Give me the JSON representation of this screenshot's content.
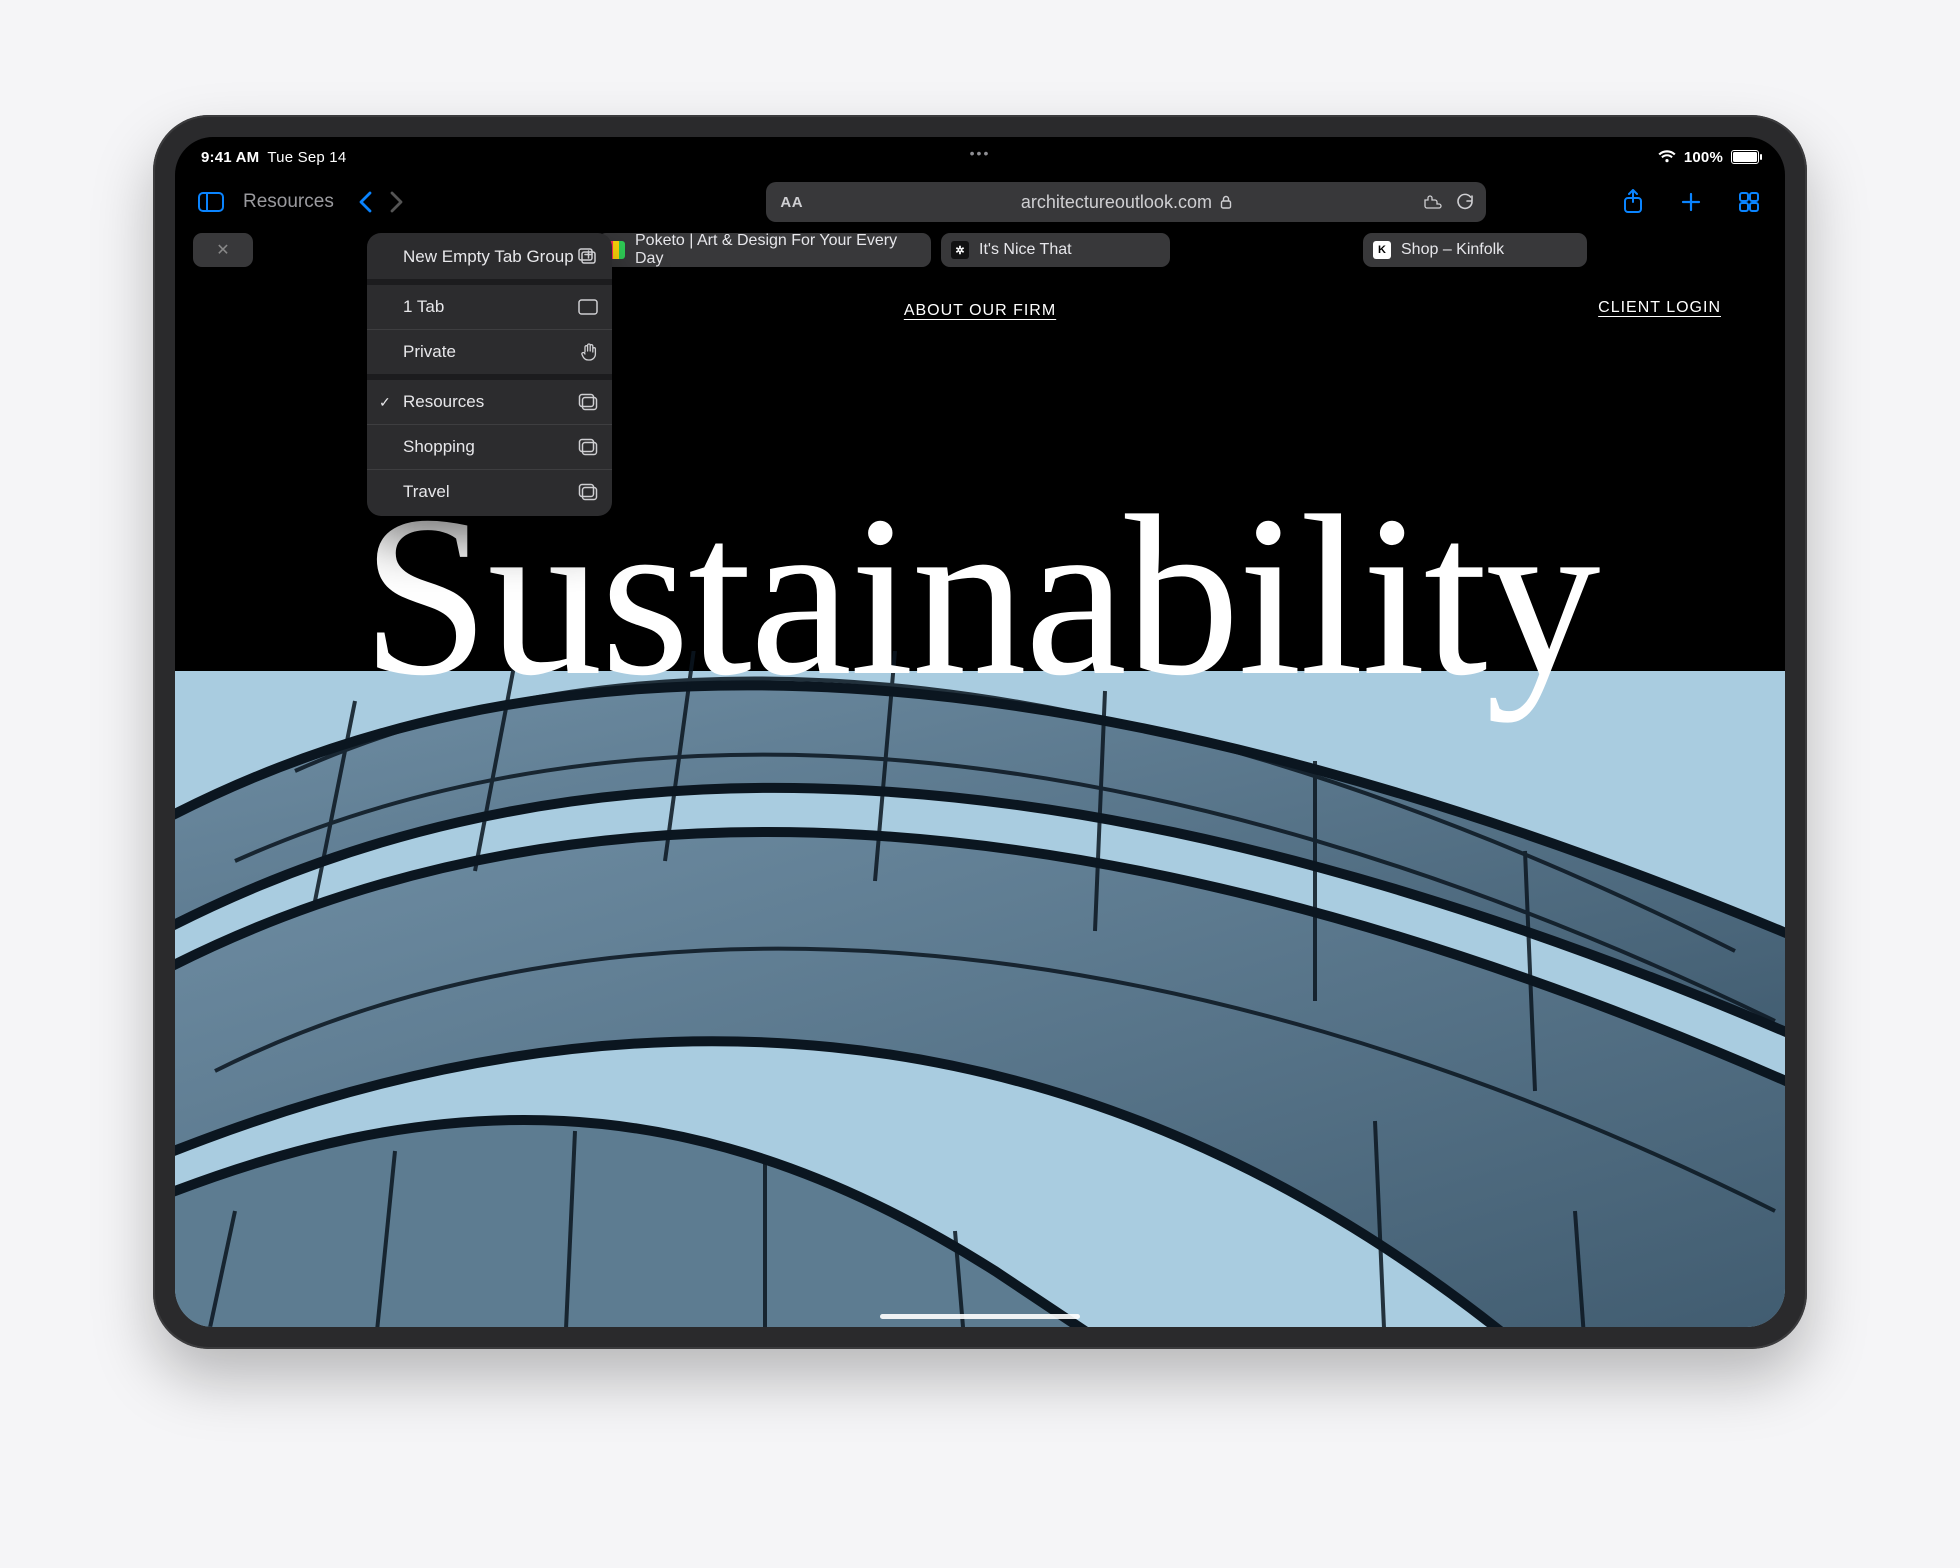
{
  "statusbar": {
    "time": "9:41 AM",
    "date": "Tue Sep 14",
    "battery_pct": "100%"
  },
  "toolbar": {
    "tabgroup_label": "Resources",
    "address_aa": "AA",
    "address_url": "architectureoutlook.com"
  },
  "tabs": [
    {
      "label": ""
    },
    {
      "label": "Poketo | Art & Design For Your Every Day"
    },
    {
      "label": "It's Nice That"
    },
    {
      "label": "Shop – Kinfolk"
    }
  ],
  "dropdown": {
    "items": [
      {
        "label": "New Empty Tab Group",
        "checked": false,
        "icon": "new-group",
        "sep_heavy": true
      },
      {
        "label": "1 Tab",
        "checked": false,
        "icon": "window",
        "sep_heavy": false
      },
      {
        "label": "Private",
        "checked": false,
        "icon": "hand",
        "sep_heavy": true
      },
      {
        "label": "Resources",
        "checked": true,
        "icon": "stack",
        "sep_heavy": false
      },
      {
        "label": "Shopping",
        "checked": false,
        "icon": "stack",
        "sep_heavy": false
      },
      {
        "label": "Travel",
        "checked": false,
        "icon": "stack",
        "sep_heavy": false
      }
    ]
  },
  "page": {
    "nav_center": "ABOUT OUR FIRM",
    "nav_right": "CLIENT LOGIN",
    "hero": "Sustainability"
  }
}
